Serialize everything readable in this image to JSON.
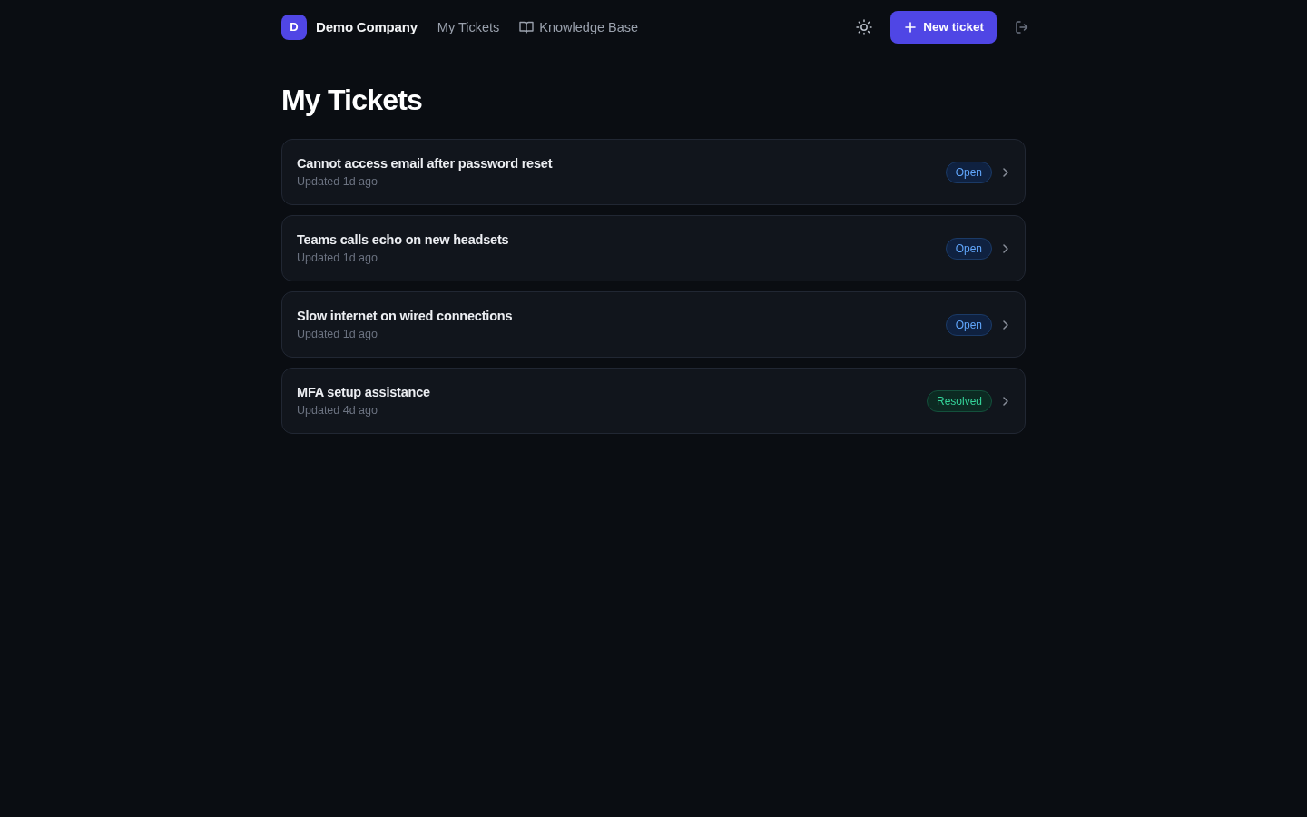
{
  "header": {
    "logo_letter": "D",
    "company": "Demo Company",
    "nav": [
      "My Tickets",
      "Knowledge Base"
    ],
    "new_ticket_button": "New ticket"
  },
  "page": {
    "title": "My Tickets"
  },
  "tickets": [
    {
      "title": "Cannot access email after password reset",
      "updated": "Updated 1d ago",
      "status": "Open",
      "kind": "open"
    },
    {
      "title": "Teams calls echo on new headsets",
      "updated": "Updated 1d ago",
      "status": "Open",
      "kind": "open"
    },
    {
      "title": "Slow internet on wired connections",
      "updated": "Updated 1d ago",
      "status": "Open",
      "kind": "open"
    },
    {
      "title": "MFA setup assistance",
      "updated": "Updated 4d ago",
      "status": "Resolved",
      "kind": "resolved"
    }
  ]
}
